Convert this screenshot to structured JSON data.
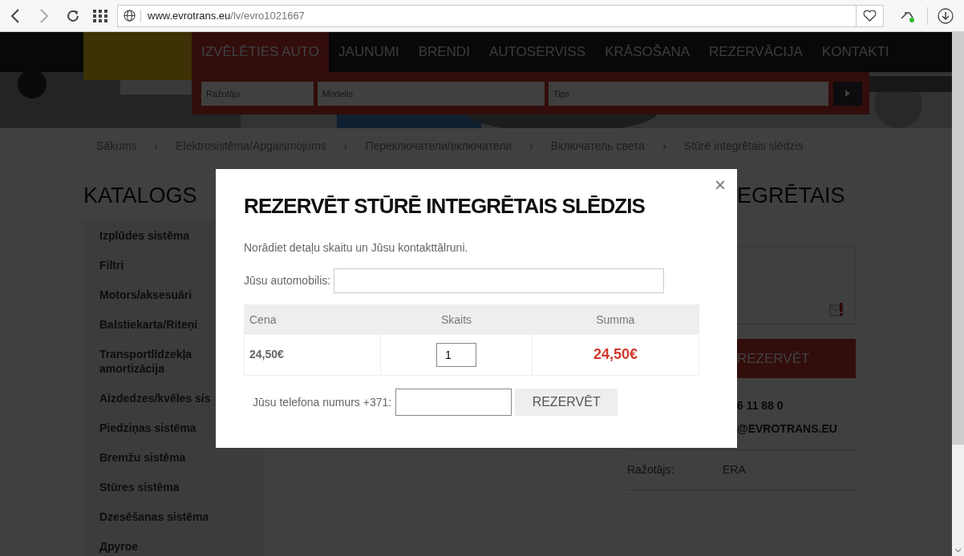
{
  "browser": {
    "url_host": "www.evrotrans.eu",
    "url_path": "/lv/evro1021667"
  },
  "nav": [
    {
      "label": "IZVĒLĒTIES AUTO",
      "selected": true
    },
    {
      "label": "JAUNUMI",
      "selected": false
    },
    {
      "label": "BRENDI",
      "selected": false
    },
    {
      "label": "AUTOSERVISS",
      "selected": false
    },
    {
      "label": "KRĀSOŠANA",
      "selected": false
    },
    {
      "label": "REZERVĀCIJA",
      "selected": false
    },
    {
      "label": "KONTAKTI",
      "selected": false
    }
  ],
  "filters": [
    {
      "placeholder": "Ražotājs"
    },
    {
      "placeholder": "Modelis"
    },
    {
      "placeholder": "Tips"
    }
  ],
  "breadcrumbs": {
    "separator": "›",
    "items": [
      "Sākums",
      "Elektrosistēma/Apgaismojums",
      "Переключатели/включатели",
      "Включатель света",
      "Stūrē integrētais slēdzis"
    ]
  },
  "catalog": {
    "title": "KATALOGS",
    "items": [
      "Izplūdes sistēma",
      "Filtri",
      "Motors/aksesuāri",
      "Balstiekarta/Riteņi",
      "Transportlīdzekļa amortizācija",
      "Aizdedzes/kvēles sis",
      "Piedziņas sistēma",
      "Bremžu sistēma",
      "Stūres sistēma",
      "Dzesēšanas sistēma",
      "Другое"
    ]
  },
  "product": {
    "title": "EGRĒTAIS",
    "reserve_button": "REZERVĒT",
    "phone": "6 11 88 0",
    "email": "@EVROTRANS.EU",
    "specs": [
      {
        "label": "Ražotājs:",
        "value": "ERA"
      }
    ]
  },
  "modal": {
    "close": "×",
    "title": "REZERVĒT STŪRĒ INTEGRĒTAIS SLĒDZIS",
    "instruction": "Norādiet detaļu skaitu un Jūsu kontakttālruni.",
    "car_label": "Jūsu automobilis:",
    "columns": [
      "Cena",
      "Skaits",
      "Summa"
    ],
    "row": {
      "price": "24,50€",
      "quantity": "1",
      "sum": "24,50€"
    },
    "phone_label": "Jūsu telefona numurs +371:",
    "submit": "REZERVĒT"
  }
}
